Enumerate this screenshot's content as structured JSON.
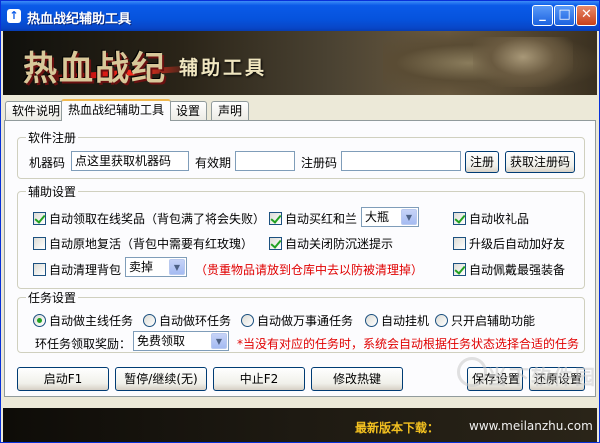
{
  "window": {
    "title": "热血战纪辅助工具",
    "controls": {
      "minimize": "_",
      "maximize": "□",
      "close": "✕"
    }
  },
  "banner": {
    "logo_text": "热血战纪",
    "subtitle": "辅助工具"
  },
  "tabs": [
    {
      "label": "软件说明",
      "active": false
    },
    {
      "label": "热血战纪辅助工具",
      "active": true
    },
    {
      "label": "设置",
      "active": false
    },
    {
      "label": "声明",
      "active": false
    }
  ],
  "registration": {
    "title": "软件注册",
    "machine_code_label": "机器码",
    "machine_code_value": "点这里获取机器码",
    "expiry_label": "有效期",
    "expiry_value": "",
    "reg_code_label": "注册码",
    "reg_code_value": "",
    "register_button": "注册",
    "get_reg_code_button": "获取注册码"
  },
  "assist": {
    "title": "辅助设置",
    "options": [
      {
        "label": "自动领取在线奖品（背包满了将会失败）",
        "checked": true
      },
      {
        "label": "自动买红和兰",
        "checked": true
      },
      {
        "label": "自动收礼品",
        "checked": true
      },
      {
        "label": "自动原地复活（背包中需要有红玫瑰）",
        "checked": false
      },
      {
        "label": "自动关闭防沉迷提示",
        "checked": true
      },
      {
        "label": "升级后自动加好友",
        "checked": false
      },
      {
        "label": "自动清理背包",
        "checked": false
      },
      {
        "label": "自动佩戴最强装备",
        "checked": true
      }
    ],
    "potion_select": "大瓶",
    "cleanup_select": "卖掉",
    "warning": "（贵重物品请放到仓库中去以防被清理掉）"
  },
  "quests": {
    "title": "任务设置",
    "modes": [
      {
        "label": "自动做主线任务",
        "checked": true
      },
      {
        "label": "自动做环任务",
        "checked": false
      },
      {
        "label": "自动做万事通任务",
        "checked": false
      },
      {
        "label": "自动挂机",
        "checked": false
      },
      {
        "label": "只开启辅助功能",
        "checked": false
      }
    ],
    "reward_label": "环任务领取奖励：",
    "reward_select": "免费领取",
    "note": "*当没有对应的任务时，系统会自动根据任务状态选择合适的任务"
  },
  "buttons": {
    "start": "启动F1",
    "pause": "暂停/继续(无)",
    "stop": "中止F2",
    "hotkey": "修改热键",
    "save": "保存设置",
    "restore": "还原设置"
  },
  "footer": {
    "download_label": "最新版本下载：",
    "url": "www.meilanzhu.com"
  },
  "watermark": "当下软件园",
  "colors": {
    "titlebar": "#0a5ae8",
    "window_bg": "#ece9d8",
    "warning_text": "#e00000",
    "footer_label": "#f2c020"
  }
}
